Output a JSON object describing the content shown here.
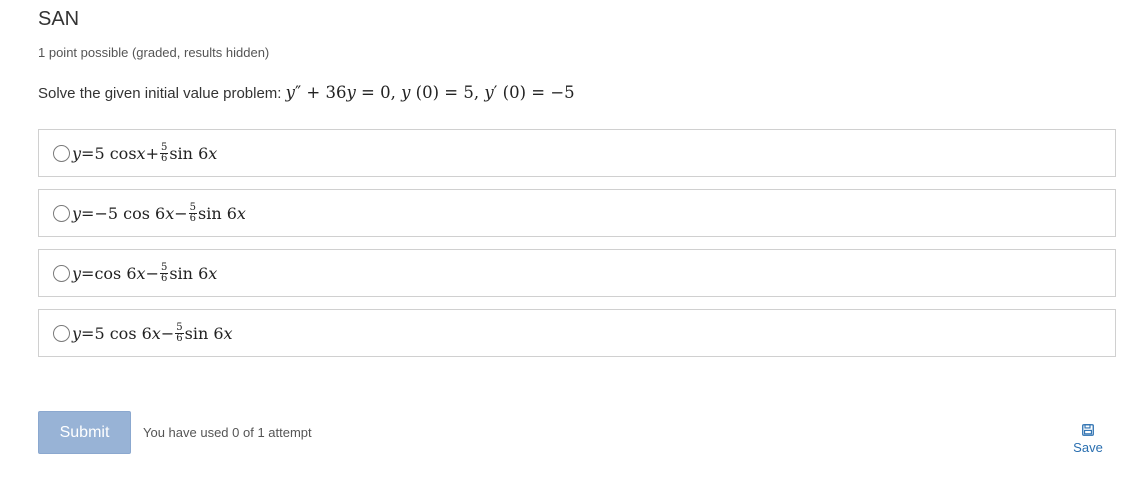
{
  "problem": {
    "title": "SAN",
    "meta": "1 point possible (graded, results hidden)",
    "prompt": "Solve the given initial value problem: "
  },
  "choices": [
    {
      "lhs": "y",
      "eq": " = ",
      "a": "5 cos ",
      "avar": "x",
      "op": " + ",
      "num": "5",
      "den": "6",
      "b": "sin 6",
      "bvar": "x"
    },
    {
      "lhs": "y",
      "eq": " = ",
      "a": "−5 cos 6",
      "avar": "x",
      "op": " − ",
      "num": "5",
      "den": "6",
      "b": "sin 6",
      "bvar": "x"
    },
    {
      "lhs": "y",
      "eq": " = ",
      "a": "cos 6",
      "avar": "x",
      "op": " − ",
      "num": "5",
      "den": "6",
      "b": "sin 6",
      "bvar": "x"
    },
    {
      "lhs": "y",
      "eq": " = ",
      "a": "5 cos 6",
      "avar": "x",
      "op": " − ",
      "num": "5",
      "den": "6",
      "b": "sin 6",
      "bvar": "x"
    }
  ],
  "actions": {
    "submit_label": "Submit",
    "attempts_text": "You have used 0 of 1 attempt",
    "save_label": "Save"
  },
  "icons": {
    "save": "floppy-disk-icon"
  },
  "colors": {
    "submit_bg": "#98b3d6",
    "link": "#2a6fb0"
  }
}
